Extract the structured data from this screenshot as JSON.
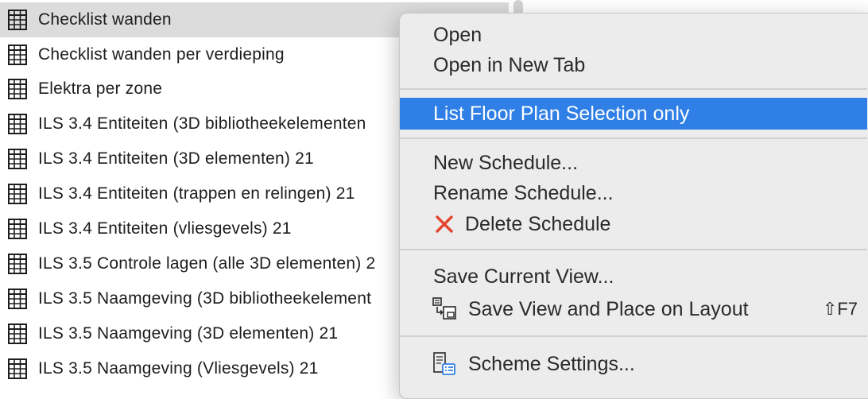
{
  "schedules": [
    {
      "name": "Checklist wanden",
      "selected": true
    },
    {
      "name": "Checklist wanden per verdieping",
      "selected": false
    },
    {
      "name": "Elektra per zone",
      "selected": false
    },
    {
      "name": "ILS 3.4 Entiteiten (3D bibliotheekelementen",
      "selected": false
    },
    {
      "name": "ILS 3.4 Entiteiten (3D elementen) 21",
      "selected": false
    },
    {
      "name": "ILS 3.4 Entiteiten (trappen en relingen) 21",
      "selected": false
    },
    {
      "name": "ILS 3.4 Entiteiten (vliesgevels) 21",
      "selected": false
    },
    {
      "name": "ILS 3.5 Controle lagen (alle 3D elementen) 2",
      "selected": false
    },
    {
      "name": "ILS 3.5 Naamgeving (3D bibliotheekelement",
      "selected": false
    },
    {
      "name": "ILS 3.5 Naamgeving (3D elementen) 21",
      "selected": false
    },
    {
      "name": "ILS 3.5 Naamgeving (Vliesgevels) 21",
      "selected": false
    }
  ],
  "context_menu": {
    "open": "Open",
    "open_new_tab": "Open in New Tab",
    "list_floor_plan_selection": "List Floor Plan Selection only",
    "new_schedule": "New Schedule...",
    "rename_schedule": "Rename Schedule...",
    "delete_schedule": "Delete Schedule",
    "save_current_view": "Save Current View...",
    "save_view_place_layout": "Save View and Place on Layout",
    "save_view_place_layout_shortcut": "⇧F7",
    "scheme_settings": "Scheme Settings..."
  },
  "icons": {
    "schedule": "schedule-grid-icon",
    "delete": "red-x-icon",
    "save_view_layout": "save-view-layout-icon",
    "scheme_settings": "scheme-settings-icon"
  },
  "colors": {
    "highlight": "#2f7fe6",
    "selected_row": "#dcdcdc",
    "delete_x": "#e2452f",
    "settings_accent": "#2f7fe6"
  }
}
